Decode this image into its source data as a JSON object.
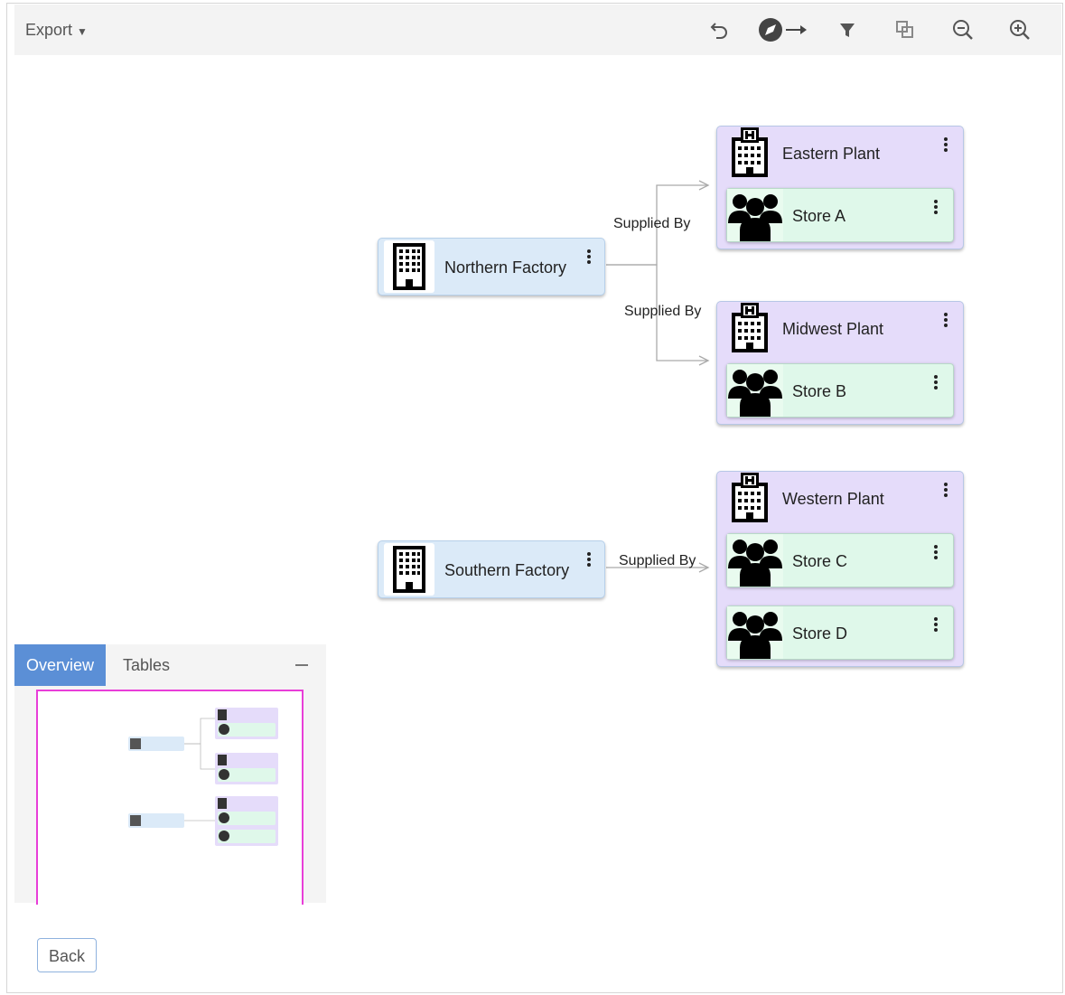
{
  "toolbar": {
    "export_label": "Export",
    "icons": [
      "undo-icon",
      "navigate-compass-icon",
      "filter-icon",
      "overlap-icon",
      "zoom-out-icon",
      "zoom-in-icon"
    ]
  },
  "graph": {
    "sources": [
      {
        "label": "Northern Factory",
        "icon": "building-icon"
      },
      {
        "label": "Southern Factory",
        "icon": "building-icon"
      }
    ],
    "edge_label": "Supplied By",
    "plants": [
      {
        "label": "Eastern Plant",
        "icon": "hospital-building-icon",
        "stores": [
          "Store A"
        ]
      },
      {
        "label": "Midwest Plant",
        "icon": "hospital-building-icon",
        "stores": [
          "Store B"
        ]
      },
      {
        "label": "Western Plant",
        "icon": "hospital-building-icon",
        "stores": [
          "Store C",
          "Store D"
        ]
      }
    ],
    "store_icon": "people-group-icon"
  },
  "panel": {
    "tabs": [
      "Overview",
      "Tables"
    ],
    "active_tab": "Overview"
  },
  "footer": {
    "back_label": "Back"
  },
  "colors": {
    "source_node": "#dbeaf8",
    "plant_group": "#e5dcfa",
    "store_node": "#dff8ea",
    "active_tab": "#5b8fd6",
    "viewport_outline": "#e83ed8"
  }
}
